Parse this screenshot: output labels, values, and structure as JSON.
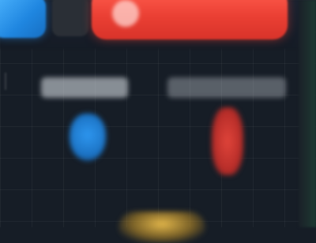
{
  "top_bar": {
    "blue_tab_label": "",
    "action_button_label": ""
  },
  "panels": {
    "left_label": "",
    "right_label": ""
  },
  "bottom": {
    "button_label": ""
  },
  "colors": {
    "background": "#161d26",
    "accent_blue": "#1f86e0",
    "accent_red": "#ea3f33",
    "accent_yellow": "#e3b74a"
  },
  "icons": {
    "action_button_icon": "circle-icon",
    "left_marker": "blue-marker-icon",
    "right_marker": "red-marker-icon"
  }
}
